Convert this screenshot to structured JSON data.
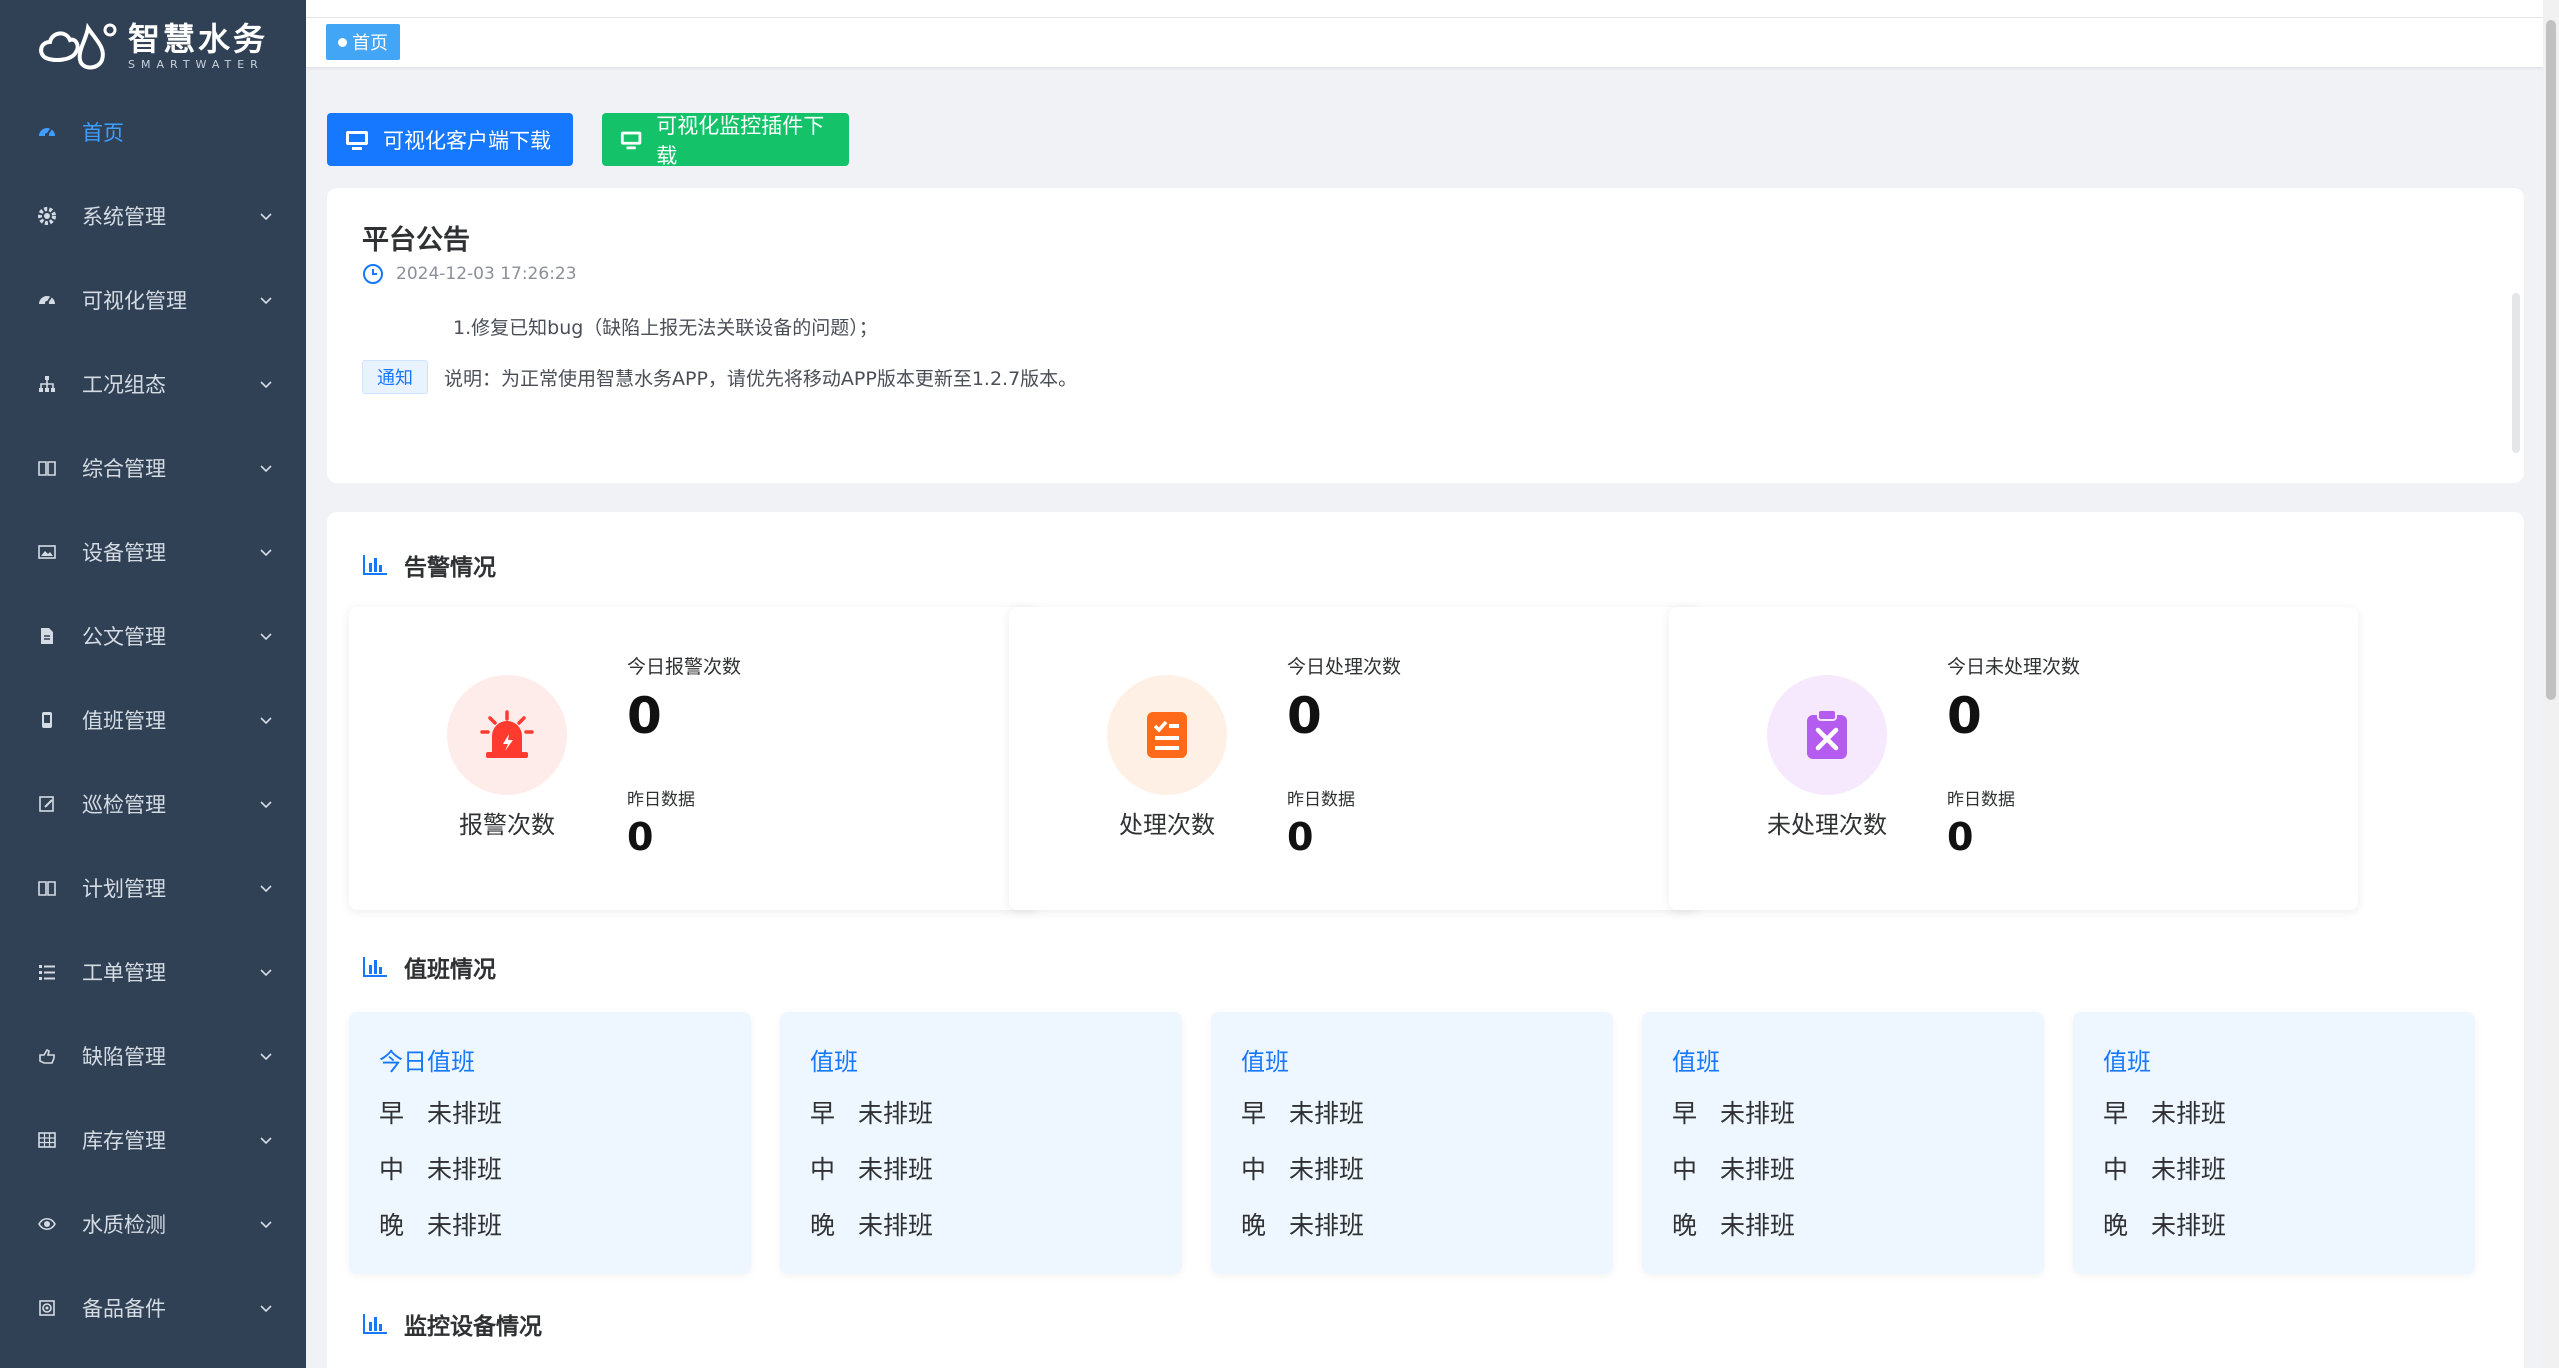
{
  "brand": {
    "title": "智慧水务",
    "subtitle": "SMARTWATER"
  },
  "sidebar": {
    "items": [
      {
        "label": "首页",
        "icon": "dashboard-icon",
        "active": true,
        "expandable": false
      },
      {
        "label": "系统管理",
        "icon": "gear-icon",
        "expandable": true
      },
      {
        "label": "可视化管理",
        "icon": "dashboard-icon",
        "expandable": true
      },
      {
        "label": "工况组态",
        "icon": "tree-icon",
        "expandable": true
      },
      {
        "label": "综合管理",
        "icon": "book-icon",
        "expandable": true
      },
      {
        "label": "设备管理",
        "icon": "image-icon",
        "expandable": true
      },
      {
        "label": "公文管理",
        "icon": "document-icon",
        "expandable": true
      },
      {
        "label": "值班管理",
        "icon": "phone-icon",
        "expandable": true
      },
      {
        "label": "巡检管理",
        "icon": "edit-icon",
        "expandable": true
      },
      {
        "label": "计划管理",
        "icon": "book-icon",
        "expandable": true
      },
      {
        "label": "工单管理",
        "icon": "list-icon",
        "expandable": true
      },
      {
        "label": "缺陷管理",
        "icon": "hand-icon",
        "expandable": true
      },
      {
        "label": "库存管理",
        "icon": "table-icon",
        "expandable": true
      },
      {
        "label": "水质检测",
        "icon": "eye-icon",
        "expandable": true
      },
      {
        "label": "备品备件",
        "icon": "box-icon",
        "expandable": true
      }
    ]
  },
  "tags": {
    "home": "首页"
  },
  "toolbar": {
    "client_download": "可视化客户端下载",
    "plugin_download": "可视化监控插件下载"
  },
  "notice": {
    "title": "平台公告",
    "time": "2024-12-03 17:26:23",
    "line1": "1.修复已知bug（缺陷上报无法关联设备的问题）；",
    "tag": "通知",
    "line2": "说明：为正常使用智慧水务APP，请优先将移动APP版本更新至1.2.7版本。"
  },
  "alarm_section": {
    "title": "告警情况",
    "cards": [
      {
        "label": "报警次数",
        "today_label": "今日报警次数",
        "today_value": "0",
        "yesterday_label": "昨日数据",
        "yesterday_value": "0",
        "icon": "siren-icon",
        "color": "#ff3b30",
        "bg": "#fdecea"
      },
      {
        "label": "处理次数",
        "today_label": "今日处理次数",
        "today_value": "0",
        "yesterday_label": "昨日数据",
        "yesterday_value": "0",
        "icon": "task-list-icon",
        "color": "#ff6a1a",
        "bg": "#fff0e6"
      },
      {
        "label": "未处理次数",
        "today_label": "今日未处理次数",
        "today_value": "0",
        "yesterday_label": "昨日数据",
        "yesterday_value": "0",
        "icon": "clipboard-x-icon",
        "color": "#b45cf0",
        "bg": "#f6e9fd"
      }
    ]
  },
  "duty_section": {
    "title": "值班情况",
    "cards": [
      {
        "title": "今日值班",
        "rows": [
          {
            "shift": "早",
            "status": "未排班"
          },
          {
            "shift": "中",
            "status": "未排班"
          },
          {
            "shift": "晚",
            "status": "未排班"
          }
        ]
      },
      {
        "title": "值班",
        "rows": [
          {
            "shift": "早",
            "status": "未排班"
          },
          {
            "shift": "中",
            "status": "未排班"
          },
          {
            "shift": "晚",
            "status": "未排班"
          }
        ]
      },
      {
        "title": "值班",
        "rows": [
          {
            "shift": "早",
            "status": "未排班"
          },
          {
            "shift": "中",
            "status": "未排班"
          },
          {
            "shift": "晚",
            "status": "未排班"
          }
        ]
      },
      {
        "title": "值班",
        "rows": [
          {
            "shift": "早",
            "status": "未排班"
          },
          {
            "shift": "中",
            "status": "未排班"
          },
          {
            "shift": "晚",
            "status": "未排班"
          }
        ]
      },
      {
        "title": "值班",
        "rows": [
          {
            "shift": "早",
            "status": "未排班"
          },
          {
            "shift": "中",
            "status": "未排班"
          },
          {
            "shift": "晚",
            "status": "未排班"
          }
        ]
      }
    ]
  },
  "monitor_section": {
    "title": "监控设备情况"
  },
  "colors": {
    "primary": "#1677ff",
    "success": "#13c269",
    "sidebar_bg": "#304156",
    "active_menu": "#409eff"
  }
}
